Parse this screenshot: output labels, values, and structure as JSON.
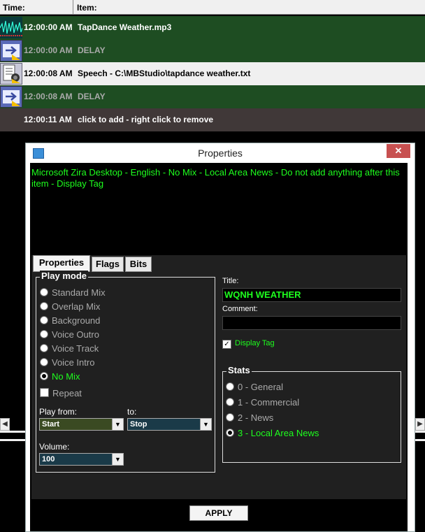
{
  "playlist": {
    "header": {
      "time": "Time:",
      "item": "Item:"
    },
    "rows": [
      {
        "time": "12:00:00 AM",
        "item": "TapDance Weather.mp3",
        "icon": "waveform-icon"
      },
      {
        "time": "12:00:00 AM",
        "item": "DELAY",
        "icon": "arrow-right-icon"
      },
      {
        "time": "12:00:08 AM",
        "item": "Speech - C:\\MBStudio\\tapdance weather.txt",
        "icon": "speech-document-icon"
      },
      {
        "time": "12:00:08 AM",
        "item": "DELAY",
        "icon": "arrow-right-icon"
      },
      {
        "time": "12:00:11 AM",
        "item": "click to add - right click to remove"
      }
    ]
  },
  "window": {
    "title": "Properties",
    "close": "✕",
    "description": "Microsoft Zira Desktop - English - No Mix - Local Area News - Do not add anything after this item - Display Tag",
    "tabs": [
      "Properties",
      "Flags",
      "Bits"
    ],
    "play_mode": {
      "title": "Play mode",
      "options": [
        "Standard Mix",
        "Overlap Mix",
        "Background",
        "Voice Outro",
        "Voice Track",
        "Voice Intro",
        "No Mix"
      ],
      "selected": "No Mix",
      "repeat_label": "Repeat"
    },
    "play_from": {
      "label": "Play from:",
      "value": "Start"
    },
    "to": {
      "label": "to:",
      "value": "Stop"
    },
    "volume": {
      "label": "Volume:",
      "value": "100"
    },
    "title_field": {
      "label": "Title:",
      "value": "WQNH WEATHER"
    },
    "comment_field": {
      "label": "Comment:",
      "value": ""
    },
    "display_tag": {
      "label": "Display Tag",
      "checked": true
    },
    "stats": {
      "title": "Stats",
      "options": [
        "0 - General",
        "1 - Commercial",
        "2 - News",
        "3 - Local Area News"
      ],
      "selected": "3 - Local Area News"
    },
    "apply_label": "APPLY"
  },
  "colors": {
    "row_green": "#1e4d22",
    "highlight_green": "#1eff1e",
    "panel": "#202020"
  }
}
